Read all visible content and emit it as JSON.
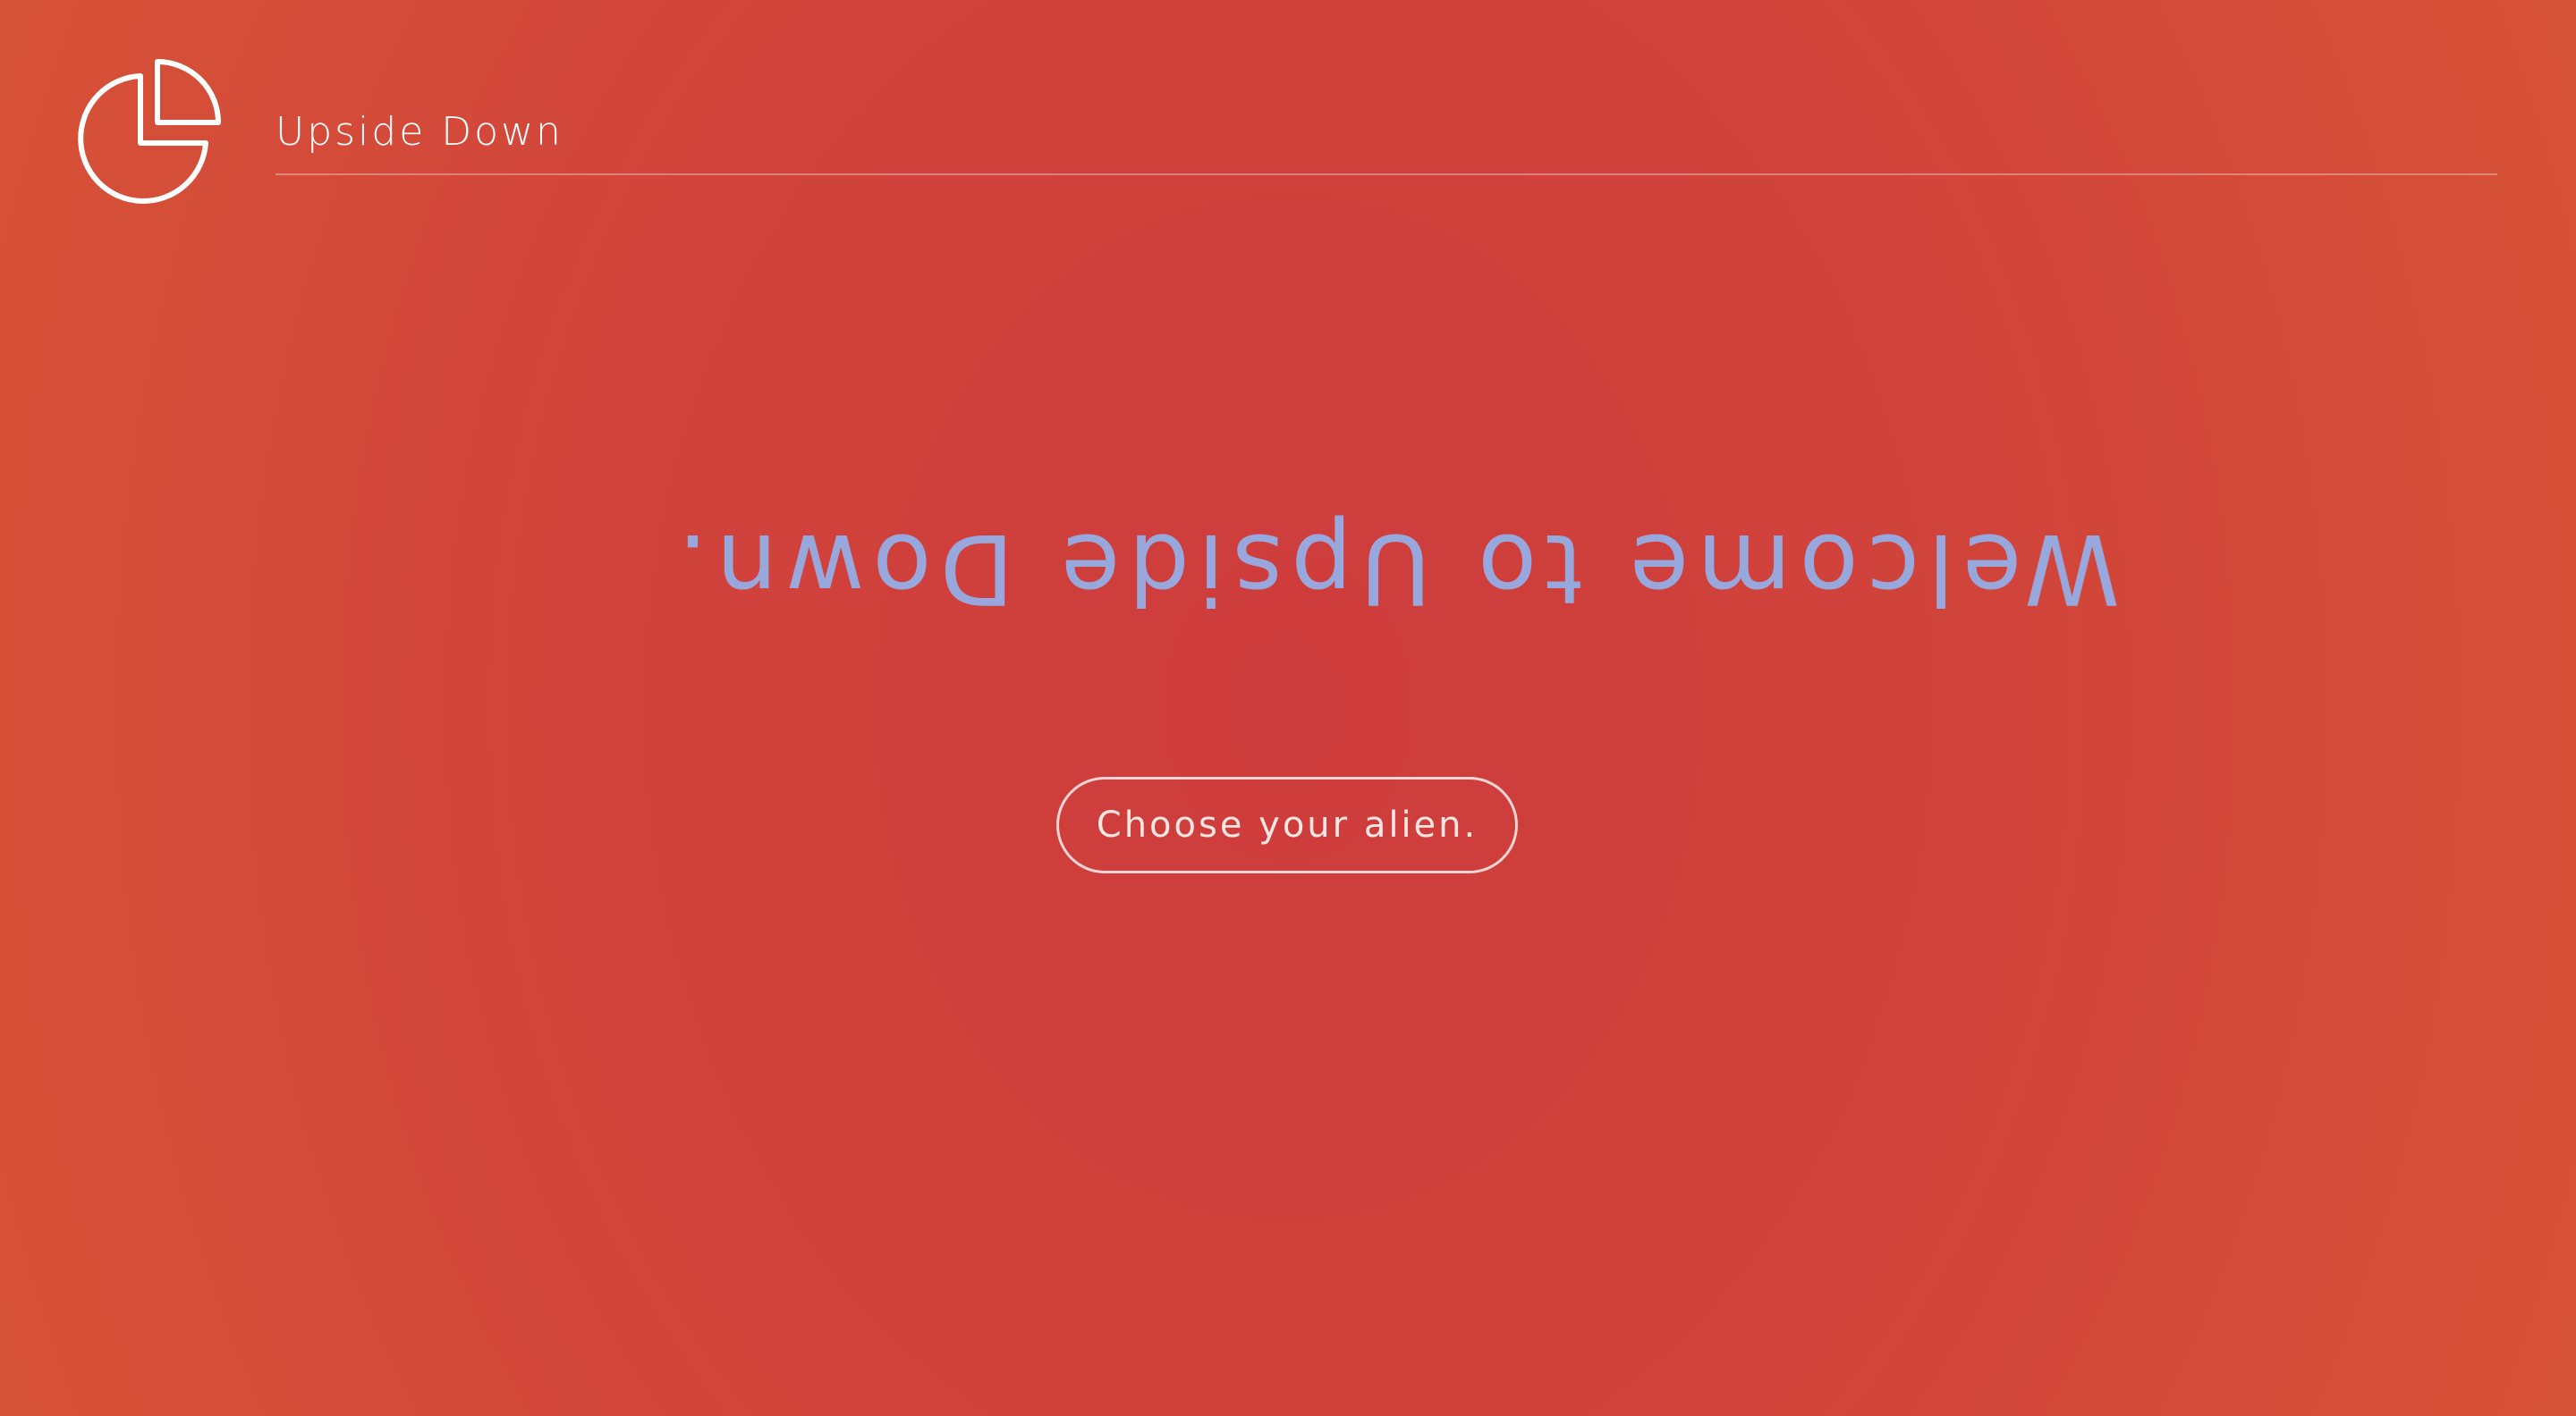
{
  "header": {
    "logo_icon": "pie-chart-icon",
    "brand_name": "Upside Down"
  },
  "hero": {
    "headline": "Welcome to Upside Down."
  },
  "cta": {
    "label": "Choose your alien."
  },
  "colors": {
    "background_center": "#cd3c3c",
    "background_edge": "#d85636",
    "headline": "#98a8dc",
    "foreground": "#ffffff"
  }
}
